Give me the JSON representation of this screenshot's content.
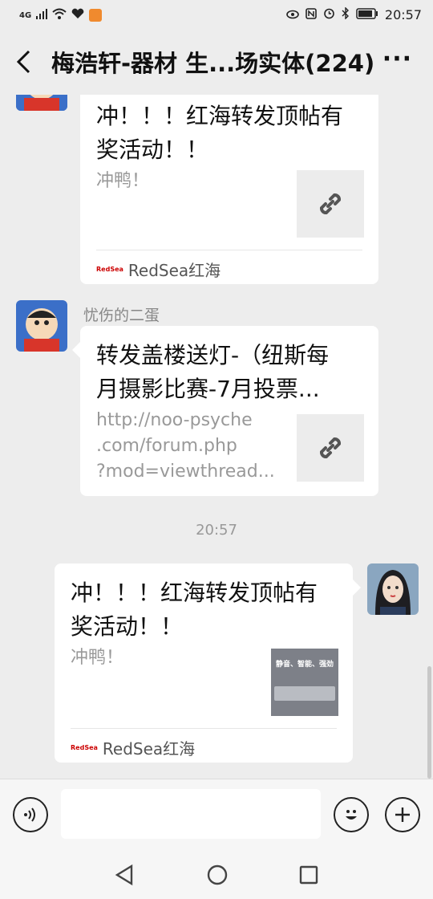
{
  "status_bar": {
    "network": "4G",
    "time": "20:57",
    "icons": [
      "signal-icon",
      "wifi-icon",
      "heart-icon",
      "app-notification-icon",
      "eye-icon",
      "nfc-icon",
      "alarm-icon",
      "bluetooth-icon",
      "battery-icon"
    ]
  },
  "header": {
    "back_icon": "back-arrow-icon",
    "title": "梅浩轩-器材 生...场实体(224)",
    "more_icon": "more-dots-icon"
  },
  "messages": [
    {
      "side": "left",
      "sender": "",
      "title_lines": [
        "冲！！！红海转发顶帖有",
        "奖活动！！"
      ],
      "desc_lines": [
        "冲鸭！"
      ],
      "thumb": "link-icon",
      "source_logo": "RedSea",
      "source": "RedSea红海"
    },
    {
      "side": "left",
      "sender": "忧伤的二蛋",
      "title_lines": [
        "转发盖楼送灯-（纽斯每",
        "月摄影比赛-7月投票..."
      ],
      "desc_lines": [
        "http://noo-psyche",
        ".com/forum.php",
        "?mod=viewthread..."
      ],
      "thumb": "link-icon"
    },
    {
      "timestamp": "20:57"
    },
    {
      "side": "right",
      "title_lines": [
        "冲！！！红海转发顶帖有",
        "奖活动！！"
      ],
      "desc_lines": [
        "冲鸭！"
      ],
      "thumb_text": "静音、智能、强劲",
      "source_logo": "RedSea",
      "source": "RedSea红海"
    }
  ],
  "input_bar": {
    "voice_icon": "voice-icon",
    "emoji_icon": "emoji-icon",
    "plus_icon": "plus-icon"
  },
  "nav_bar": {
    "back": "nav-back-icon",
    "home": "nav-home-icon",
    "recent": "nav-recent-icon"
  },
  "colors": {
    "background": "#ededed",
    "card": "#ffffff",
    "gray_text": "#999999"
  }
}
